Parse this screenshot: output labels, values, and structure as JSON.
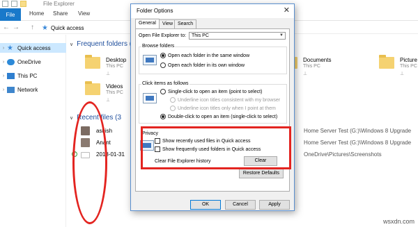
{
  "window": {
    "title": "File Explorer"
  },
  "ribbon": {
    "file_label": "File",
    "tabs": [
      "Home",
      "Share",
      "View"
    ]
  },
  "address": {
    "back": "←",
    "forward": "→",
    "up": "↑",
    "path": "Quick access"
  },
  "sidebar": {
    "items": [
      {
        "label": "Quick access",
        "selected": true
      },
      {
        "label": "OneDrive"
      },
      {
        "label": "This PC"
      },
      {
        "label": "Network"
      }
    ]
  },
  "content": {
    "frequent_title": "Frequent folders (6",
    "folders": [
      {
        "name": "Desktop",
        "sub": "This PC"
      },
      {
        "name": "Videos",
        "sub": "This PC"
      },
      {
        "name": "Documents",
        "sub": "This PC"
      },
      {
        "name": "Picture",
        "sub": "This PC"
      }
    ],
    "recent_title": "Recent files (3",
    "recent": [
      {
        "name": "ashish",
        "path": "Home Server Test (G:)\\Windows 8 Upgrade"
      },
      {
        "name": "Anant",
        "path": "Home Server Test (G:)\\Windows 8 Upgrade"
      },
      {
        "name": "2018-01-31",
        "path": "OneDrive\\Pictures\\Screenshots"
      }
    ]
  },
  "dialog": {
    "title": "Folder Options",
    "close": "✕",
    "tabs": [
      "General",
      "View",
      "Search"
    ],
    "open_label": "Open File Explorer to:",
    "open_value": "This PC",
    "browse_legend": "Browse folders",
    "browse_same": "Open each folder in the same window",
    "browse_own": "Open each folder in its own window",
    "click_legend": "Click items as follows",
    "single_click": "Single-click to open an item (point to select)",
    "underline_browser": "Underline icon titles consistent with my browser",
    "underline_point": "Underline icon titles only when I point at them",
    "double_click": "Double-click to open an item (single-click to select)",
    "privacy_legend": "Privacy",
    "show_recent": "Show recently used files in Quick access",
    "show_frequent": "Show frequently used folders in Quick access",
    "clear_history": "Clear File Explorer history",
    "clear_button": "Clear",
    "restore_button": "Restore Defaults",
    "ok_button": "OK",
    "cancel_button": "Cancel",
    "apply_button": "Apply"
  },
  "watermark": "wsxdn.com",
  "colors": {
    "accent": "#1979ca",
    "highlight": "#e32420",
    "selected": "#cce8ff"
  }
}
